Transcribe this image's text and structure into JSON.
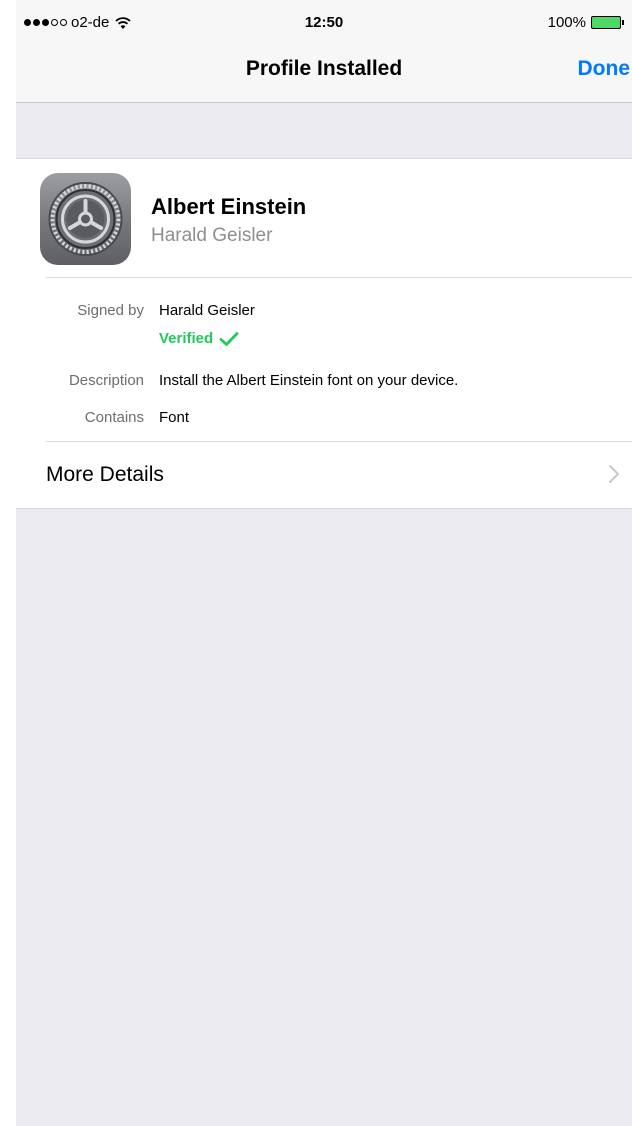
{
  "status_bar": {
    "carrier": "o2-de",
    "time": "12:50",
    "battery": "100%",
    "signal_dots_filled": 3,
    "signal_dots_total": 5,
    "battery_color": "#4cd964"
  },
  "nav": {
    "title": "Profile Installed",
    "done_label": "Done",
    "accent_color": "#007aff"
  },
  "profile": {
    "icon": "settings-gear-icon",
    "name": "Albert Einstein",
    "subtitle": "Harald Geisler"
  },
  "details": {
    "signed_by_label": "Signed by",
    "signed_by_value": "Harald Geisler",
    "verified_label": "Verified",
    "verified_color": "#21c95b",
    "description_label": "Description",
    "description_value": "Install the Albert Einstein font on your device.",
    "contains_label": "Contains",
    "contains_value": "Font"
  },
  "more_details": {
    "label": "More Details",
    "icon": "chevron-right-icon"
  }
}
